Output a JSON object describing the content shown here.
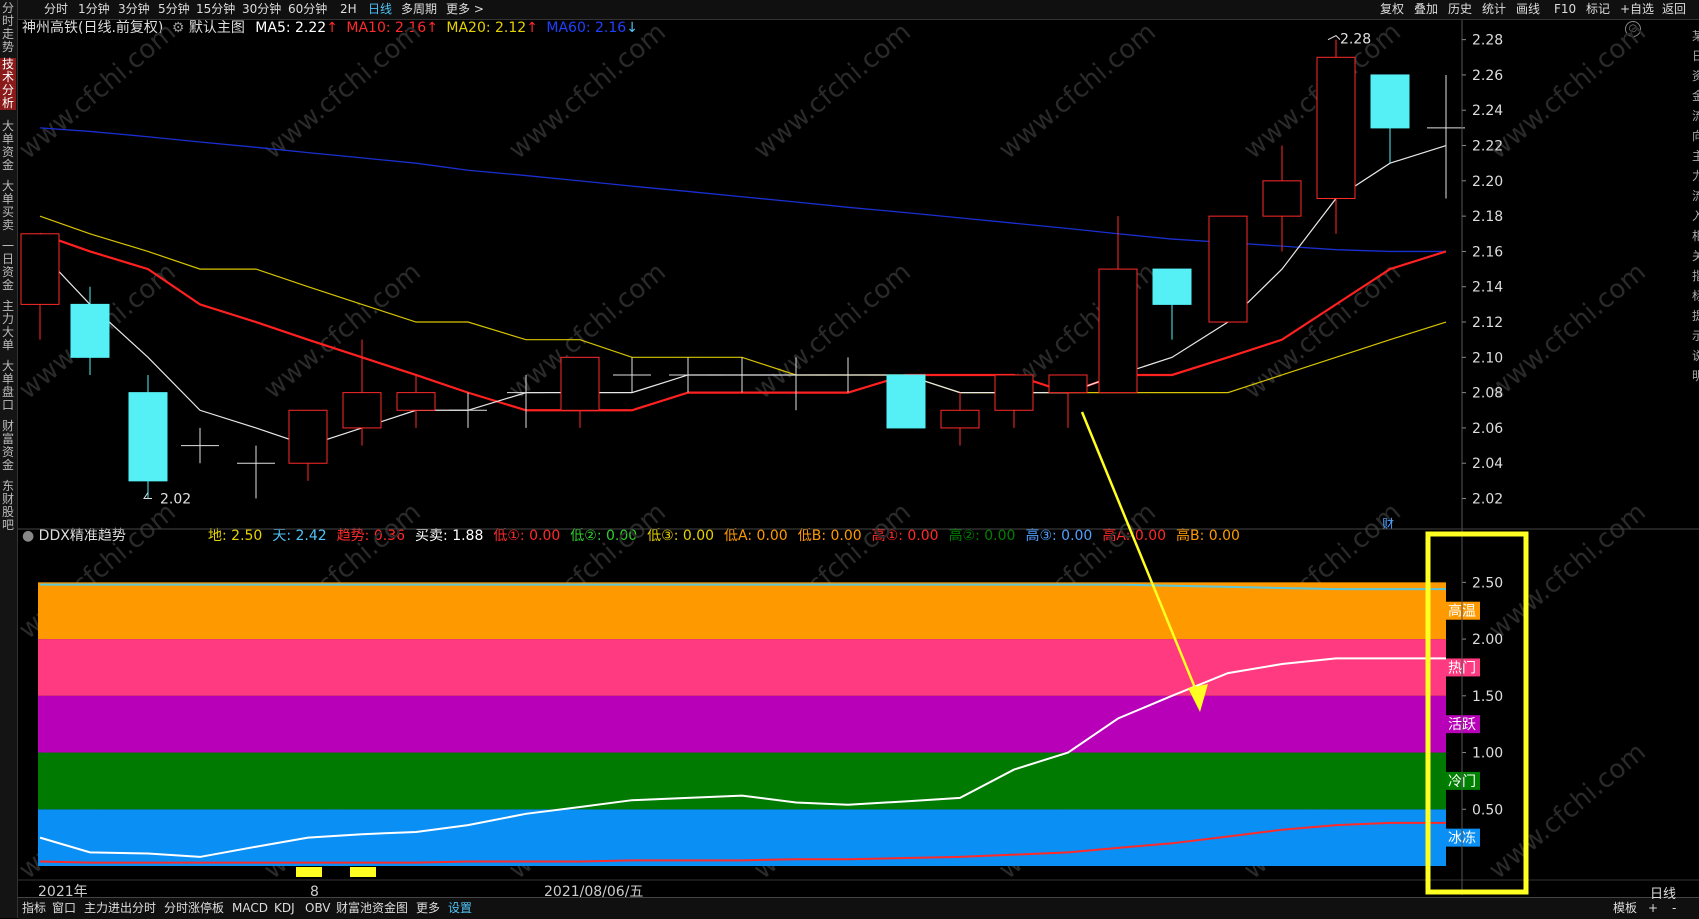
{
  "left_tabs": [
    {
      "label": "分时走势",
      "active": false
    },
    {
      "label": "技术分析",
      "active": true
    },
    {
      "label": "大单资金",
      "active": false
    },
    {
      "label": "大单买卖",
      "active": false
    },
    {
      "label": "一日资金",
      "active": false
    },
    {
      "label": "主力大单",
      "active": false
    },
    {
      "label": "大单盘口",
      "active": false
    },
    {
      "label": "财富资金",
      "active": false
    },
    {
      "label": "东财股吧",
      "active": false
    }
  ],
  "period_tabs": [
    {
      "label": "分时",
      "active": false
    },
    {
      "label": "1分钟",
      "active": false
    },
    {
      "label": "3分钟",
      "active": false
    },
    {
      "label": "5分钟",
      "active": false
    },
    {
      "label": "15分钟",
      "active": false
    },
    {
      "label": "30分钟",
      "active": false
    },
    {
      "label": "60分钟",
      "active": false
    },
    {
      "label": "2H",
      "active": false
    },
    {
      "label": "日线",
      "active": true
    },
    {
      "label": "多周期",
      "active": false
    },
    {
      "label": "更多 >",
      "active": false
    }
  ],
  "right_tools": [
    "复权",
    "叠加",
    "历史",
    "统计",
    "画线",
    "F10",
    "标记",
    "+自选",
    "返回"
  ],
  "main_chart": {
    "stock_name": "神州高铁(日线.前复权)",
    "template": "默认主图",
    "ma": [
      {
        "label": "MA5: 2.22",
        "color": "#ffffff"
      },
      {
        "label": "MA10: 2.16",
        "color": "#ff2a2a"
      },
      {
        "label": "MA20: 2.12",
        "color": "#e6d200"
      },
      {
        "label": "MA60: 2.16",
        "color": "#2040ff"
      }
    ],
    "y_ticks": [
      "2.28",
      "2.26",
      "2.24",
      "2.22",
      "2.20",
      "2.18",
      "2.16",
      "2.14",
      "2.12",
      "2.10",
      "2.08",
      "2.06",
      "2.04",
      "2.02"
    ],
    "high_label": "2.28",
    "low_label": "2.02",
    "fin_marker": "财",
    "right_edge_text": "某日资金流向主力流入相关指标提示说明"
  },
  "chart_data": [
    {
      "type": "candlestick",
      "title": "神州高铁(日线.前复权)",
      "ylim": [
        2.01,
        2.29
      ],
      "candles": [
        {
          "o": 2.13,
          "c": 2.17,
          "h": 2.17,
          "l": 2.11
        },
        {
          "o": 2.13,
          "c": 2.1,
          "h": 2.14,
          "l": 2.09
        },
        {
          "o": 2.08,
          "c": 2.03,
          "h": 2.09,
          "l": 2.02
        },
        {
          "o": 2.05,
          "c": 2.05,
          "h": 2.06,
          "l": 2.04
        },
        {
          "o": 2.04,
          "c": 2.04,
          "h": 2.05,
          "l": 2.02
        },
        {
          "o": 2.04,
          "c": 2.07,
          "h": 2.07,
          "l": 2.03
        },
        {
          "o": 2.06,
          "c": 2.08,
          "h": 2.11,
          "l": 2.05
        },
        {
          "o": 2.07,
          "c": 2.08,
          "h": 2.09,
          "l": 2.06
        },
        {
          "o": 2.07,
          "c": 2.07,
          "h": 2.08,
          "l": 2.06
        },
        {
          "o": 2.08,
          "c": 2.08,
          "h": 2.09,
          "l": 2.06
        },
        {
          "o": 2.07,
          "c": 2.1,
          "h": 2.1,
          "l": 2.06
        },
        {
          "o": 2.09,
          "c": 2.09,
          "h": 2.1,
          "l": 2.08
        },
        {
          "o": 2.09,
          "c": 2.09,
          "h": 2.1,
          "l": 2.08
        },
        {
          "o": 2.09,
          "c": 2.09,
          "h": 2.1,
          "l": 2.08
        },
        {
          "o": 2.09,
          "c": 2.09,
          "h": 2.1,
          "l": 2.07
        },
        {
          "o": 2.09,
          "c": 2.09,
          "h": 2.1,
          "l": 2.08
        },
        {
          "o": 2.09,
          "c": 2.06,
          "h": 2.09,
          "l": 2.06
        },
        {
          "o": 2.06,
          "c": 2.07,
          "h": 2.08,
          "l": 2.05
        },
        {
          "o": 2.07,
          "c": 2.09,
          "h": 2.09,
          "l": 2.06
        },
        {
          "o": 2.08,
          "c": 2.09,
          "h": 2.09,
          "l": 2.06
        },
        {
          "o": 2.08,
          "c": 2.15,
          "h": 2.18,
          "l": 2.08
        },
        {
          "o": 2.15,
          "c": 2.13,
          "h": 2.15,
          "l": 2.11
        },
        {
          "o": 2.12,
          "c": 2.18,
          "h": 2.18,
          "l": 2.12
        },
        {
          "o": 2.18,
          "c": 2.2,
          "h": 2.22,
          "l": 2.16
        },
        {
          "o": 2.19,
          "c": 2.27,
          "h": 2.28,
          "l": 2.17
        },
        {
          "o": 2.26,
          "c": 2.23,
          "h": 2.26,
          "l": 2.21
        },
        {
          "o": 2.23,
          "c": 2.23,
          "h": 2.26,
          "l": 2.19
        }
      ],
      "ma5": [
        2.16,
        2.13,
        2.1,
        2.07,
        2.06,
        2.05,
        2.06,
        2.07,
        2.07,
        2.08,
        2.08,
        2.08,
        2.09,
        2.09,
        2.09,
        2.09,
        2.09,
        2.08,
        2.08,
        2.08,
        2.09,
        2.1,
        2.12,
        2.15,
        2.19,
        2.21,
        2.22
      ],
      "ma10": [
        2.17,
        2.16,
        2.15,
        2.13,
        2.12,
        2.11,
        2.1,
        2.09,
        2.08,
        2.07,
        2.07,
        2.07,
        2.08,
        2.08,
        2.08,
        2.08,
        2.09,
        2.09,
        2.09,
        2.08,
        2.09,
        2.09,
        2.1,
        2.11,
        2.13,
        2.15,
        2.16
      ],
      "ma20": [
        2.18,
        2.17,
        2.16,
        2.15,
        2.15,
        2.14,
        2.13,
        2.12,
        2.12,
        2.11,
        2.11,
        2.1,
        2.1,
        2.1,
        2.09,
        2.09,
        2.09,
        2.08,
        2.08,
        2.08,
        2.08,
        2.08,
        2.08,
        2.09,
        2.1,
        2.11,
        2.12
      ],
      "ma60": [
        2.23,
        2.228,
        2.225,
        2.222,
        2.219,
        2.216,
        2.213,
        2.21,
        2.206,
        2.203,
        2.2,
        2.197,
        2.194,
        2.191,
        2.188,
        2.185,
        2.182,
        2.179,
        2.176,
        2.173,
        2.17,
        2.167,
        2.165,
        2.163,
        2.161,
        2.16,
        2.16
      ]
    },
    {
      "type": "line",
      "title": "DDX精准趋势",
      "ylim": [
        0,
        2.6
      ],
      "zones": [
        {
          "name": "冰冻",
          "from": 0,
          "to": 0.5,
          "color": "#0a8ff5"
        },
        {
          "name": "冷门",
          "from": 0.5,
          "to": 1.0,
          "color": "#007a00"
        },
        {
          "name": "活跃",
          "from": 1.0,
          "to": 1.5,
          "color": "#b800b8"
        },
        {
          "name": "热门",
          "from": 1.5,
          "to": 2.0,
          "color": "#ff3a80"
        },
        {
          "name": "高温",
          "from": 2.0,
          "to": 2.5,
          "color": "#ff9900"
        }
      ],
      "series": [
        {
          "name": "天",
          "color": "#ffffff",
          "values": [
            0.25,
            0.12,
            0.11,
            0.08,
            0.17,
            0.25,
            0.28,
            0.3,
            0.36,
            0.46,
            0.52,
            0.58,
            0.6,
            0.62,
            0.56,
            0.54,
            0.57,
            0.6,
            0.85,
            1.0,
            1.3,
            1.5,
            1.7,
            1.78,
            1.83,
            1.83,
            1.83
          ]
        },
        {
          "name": "地",
          "color": "#ff2a2a",
          "values": [
            0.04,
            0.03,
            0.03,
            0.03,
            0.03,
            0.03,
            0.03,
            0.03,
            0.04,
            0.04,
            0.04,
            0.05,
            0.05,
            0.05,
            0.06,
            0.06,
            0.07,
            0.08,
            0.1,
            0.12,
            0.16,
            0.2,
            0.26,
            0.32,
            0.36,
            0.38,
            0.38
          ]
        },
        {
          "name": "top",
          "color": "#5fc8d8",
          "values": [
            2.48,
            2.48,
            2.48,
            2.48,
            2.48,
            2.48,
            2.48,
            2.48,
            2.48,
            2.48,
            2.48,
            2.48,
            2.48,
            2.48,
            2.48,
            2.48,
            2.48,
            2.48,
            2.48,
            2.48,
            2.48,
            2.47,
            2.46,
            2.45,
            2.44,
            2.44,
            2.44
          ]
        }
      ],
      "y_ticks": [
        "2.50",
        "2.00",
        "1.50",
        "1.00",
        "0.50"
      ]
    }
  ],
  "sub_chart": {
    "title": "DDX精准趋势",
    "legend": [
      {
        "label": "地: 2.50",
        "color": "#e6d200"
      },
      {
        "label": "天: 2.42",
        "color": "#4fc3f7"
      },
      {
        "label": "趋势: 0.36",
        "color": "#ff2a2a"
      },
      {
        "label": "买卖: 1.88",
        "color": "#ffffff"
      },
      {
        "label": "低①: 0.00",
        "color": "#ff2a2a"
      },
      {
        "label": "低②: 0.00",
        "color": "#30d030"
      },
      {
        "label": "低③: 0.00",
        "color": "#e6d200"
      },
      {
        "label": "低A: 0.00",
        "color": "#ff9900"
      },
      {
        "label": "低B: 0.00",
        "color": "#ff9900"
      },
      {
        "label": "高①: 0.00",
        "color": "#ff2a2a"
      },
      {
        "label": "高②: 0.00",
        "color": "#008000"
      },
      {
        "label": "高③: 0.00",
        "color": "#4fa0ff"
      },
      {
        "label": "高A: 0.00",
        "color": "#ff2a2a"
      },
      {
        "label": "高B: 0.00",
        "color": "#ff9900"
      }
    ],
    "zone_labels": [
      {
        "label": "高温",
        "color": "#ff9900"
      },
      {
        "label": "热门",
        "color": "#ff3a80"
      },
      {
        "label": "活跃",
        "color": "#b800b8"
      },
      {
        "label": "冷门",
        "color": "#008000"
      },
      {
        "label": "冰冻",
        "color": "#0a8ff5"
      }
    ],
    "date_labels": [
      "2021年",
      "8",
      "2021/08/06/五"
    ]
  },
  "bottom_tabs": [
    "指标",
    "窗口",
    "主力进出分时",
    "分时涨停板",
    "MACD",
    "KDJ",
    "OBV",
    "财富池资金图",
    "更多",
    "设置"
  ],
  "bottom_right": [
    "模板",
    "+",
    "-",
    "日线"
  ],
  "watermark": "www.cfchi.com",
  "colors": {
    "up": "#ff2a2a",
    "down": "#55f0f5",
    "annotation": "#ffff22"
  }
}
